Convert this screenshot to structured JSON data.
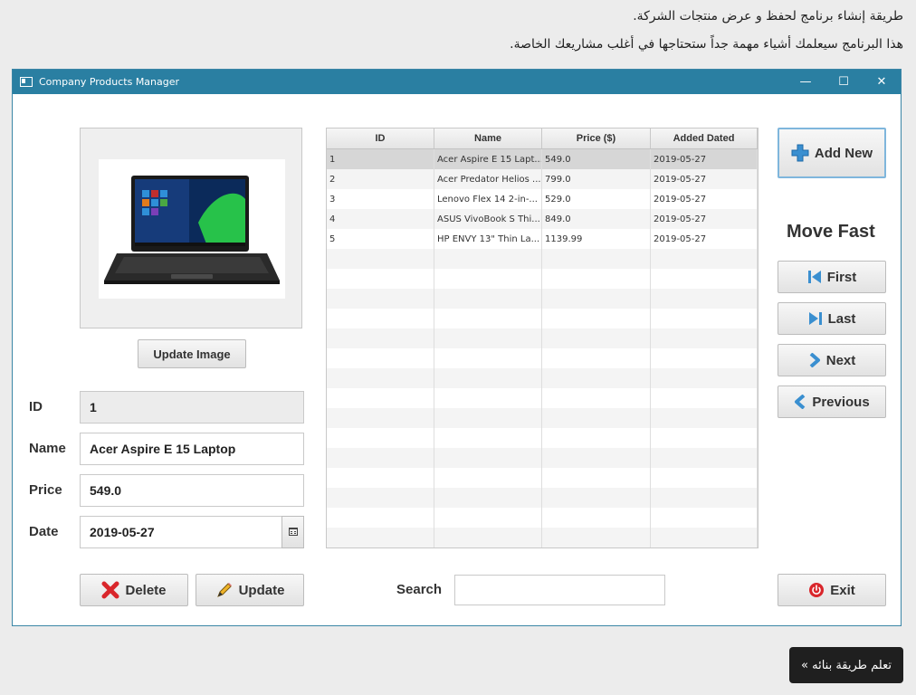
{
  "page": {
    "line1": "طريقة إنشاء برنامج لحفظ و عرض منتجات الشركة.",
    "line2": "هذا البرنامج سيعلمك أشياء مهمة جداً ستحتاجها في أغلب مشاريعك الخاصة.",
    "learn_button": "تعلم طريقة بنائه »"
  },
  "window": {
    "title": "Company Products Manager",
    "controls": {
      "minimize": "—",
      "maximize": "☐",
      "close": "✕"
    }
  },
  "left": {
    "update_image": "Update Image",
    "labels": {
      "id": "ID",
      "name": "Name",
      "price": "Price",
      "date": "Date"
    },
    "values": {
      "id": "1",
      "name": "Acer Aspire E 15 Laptop",
      "price": "549.0",
      "date": "2019-05-27"
    },
    "delete": "Delete",
    "update": "Update"
  },
  "table": {
    "headers": [
      "ID",
      "Name",
      "Price ($)",
      "Added Dated"
    ],
    "rows": [
      [
        "1",
        "Acer Aspire E 15 Lapt...",
        "549.0",
        "2019-05-27"
      ],
      [
        "2",
        "Acer Predator Helios ...",
        "799.0",
        "2019-05-27"
      ],
      [
        "3",
        "Lenovo Flex 14 2-in-...",
        "529.0",
        "2019-05-27"
      ],
      [
        "4",
        "ASUS VivoBook S Thi...",
        "849.0",
        "2019-05-27"
      ],
      [
        "5",
        "HP ENVY 13\" Thin La...",
        "1139.99",
        "2019-05-27"
      ]
    ]
  },
  "right": {
    "add_new": "Add New",
    "move_fast": "Move Fast",
    "first": "First",
    "last": "Last",
    "next": "Next",
    "previous": "Previous",
    "exit": "Exit"
  },
  "search": {
    "label": "Search",
    "value": ""
  },
  "colors": {
    "titlebar": "#2a7fa2",
    "accent_blue": "#3a8fd0",
    "delete_red": "#d9262b",
    "exit_red": "#d9262b"
  }
}
